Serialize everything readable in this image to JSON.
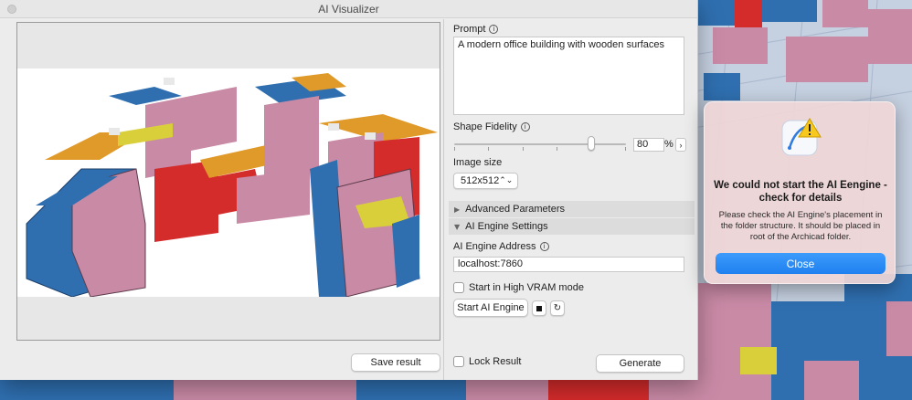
{
  "window": {
    "title": "AI Visualizer"
  },
  "left": {
    "save_label": "Save result"
  },
  "prompt": {
    "label": "Prompt",
    "value": "A modern office building with wooden surfaces"
  },
  "fidelity": {
    "label": "Shape Fidelity",
    "value": "80",
    "unit": "%",
    "level": 0.8
  },
  "image_size": {
    "label": "Image size",
    "value": "512x512"
  },
  "advanced": {
    "label": "Advanced Parameters",
    "expanded": false
  },
  "engine": {
    "section_label": "AI Engine Settings",
    "address_label": "AI Engine Address",
    "address_value": "localhost:7860",
    "high_vram_label": "Start in High VRAM mode",
    "start_label": "Start AI Engine"
  },
  "footer": {
    "lock_label": "Lock Result",
    "generate_label": "Generate"
  },
  "alert": {
    "title": "We could not start the AI Eengine - check for details",
    "body": "Please check the AI Engine's placement in the folder structure. It should be placed in root of the Archicad folder.",
    "button": "Close"
  },
  "icons": {
    "info": "info-icon",
    "stop": "stop-icon",
    "refresh": "refresh-icon",
    "warning": "warning-icon",
    "chevron": "chevron-right-icon",
    "updown": "updown-chevron-icon",
    "disclosure": "disclosure-triangle-icon"
  },
  "colors": {
    "alert_button": "#1f80f0",
    "block_blue": "#2f6fb0",
    "block_pink": "#c98aa6",
    "block_red": "#d42b2b",
    "block_orange": "#e09a2a",
    "block_yellow": "#d8cf3a"
  }
}
